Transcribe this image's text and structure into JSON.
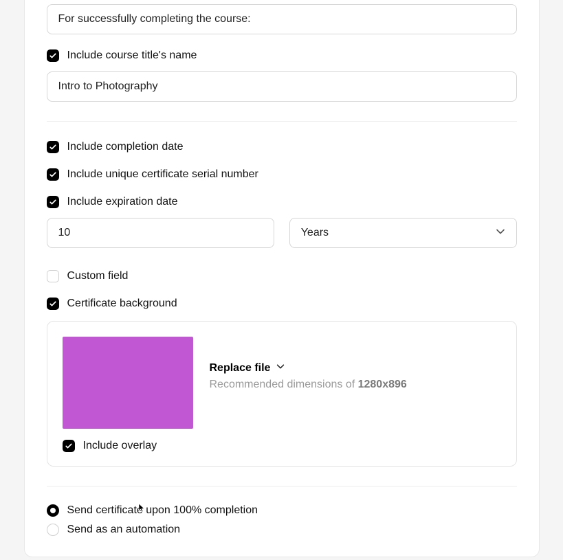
{
  "completion_text": {
    "value": "For successfully completing the course:"
  },
  "course_title": {
    "checkbox_label": "Include course title's name",
    "value": "Intro to Photography"
  },
  "options": {
    "completion_date_label": "Include completion date",
    "serial_label": "Include unique certificate serial number",
    "expiration_label": "Include expiration date",
    "custom_field_label": "Custom field",
    "background_label": "Certificate background"
  },
  "expiration": {
    "amount": "10",
    "unit": "Years"
  },
  "background": {
    "replace_label": "Replace file",
    "recommended_prefix": "Recommended dimensions of ",
    "recommended_dims": "1280x896",
    "overlay_label": "Include overlay",
    "thumb_color": "#c157d3"
  },
  "send": {
    "on_complete": "Send certificate upon 100% completion",
    "as_automation": "Send as an automation"
  }
}
